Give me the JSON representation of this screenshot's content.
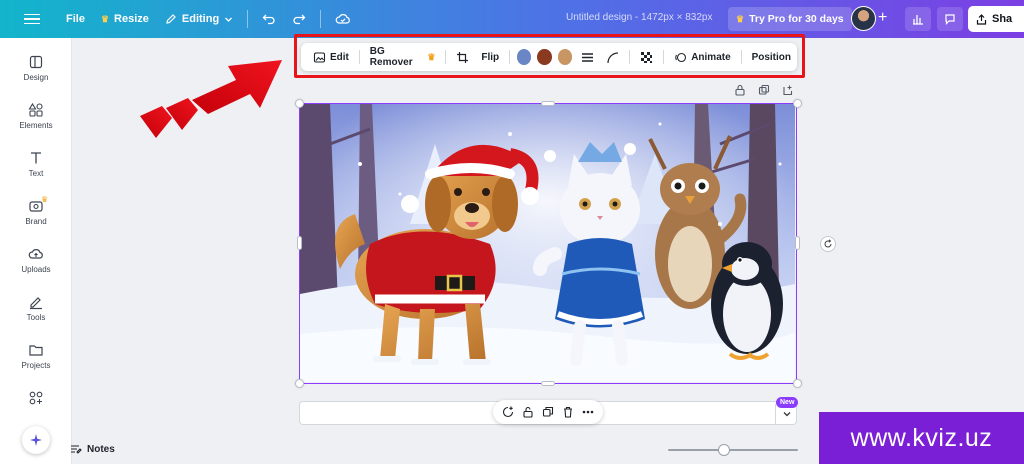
{
  "topbar": {
    "file_label": "File",
    "resize_label": "Resize",
    "editing_label": "Editing",
    "doc_title": "Untitled design - 1472px × 832px",
    "try_pro_label": "Try Pro for 30 days",
    "share_label": "Sha"
  },
  "sidebar": {
    "items": [
      {
        "label": "Design"
      },
      {
        "label": "Elements"
      },
      {
        "label": "Text"
      },
      {
        "label": "Brand"
      },
      {
        "label": "Uploads"
      },
      {
        "label": "Tools"
      },
      {
        "label": "Projects"
      }
    ]
  },
  "context_toolbar": {
    "edit_label": "Edit",
    "bg_remover_label": "BG Remover",
    "flip_label": "Flip",
    "animate_label": "Animate",
    "position_label": "Position",
    "swatch_colors": [
      "#6b86c4",
      "#8a3a1e",
      "#c89662"
    ]
  },
  "bottom": {
    "new_badge": "New",
    "notes_label": "Notes"
  },
  "watermark": {
    "text": "www.kviz.uz"
  },
  "colors": {
    "accent": "#8b3dff",
    "highlight": "#e8141a"
  }
}
